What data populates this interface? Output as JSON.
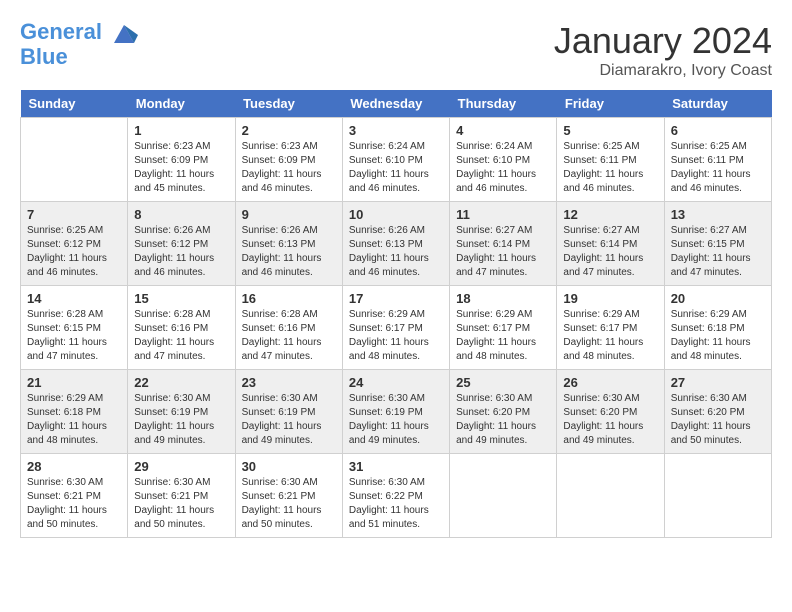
{
  "header": {
    "logo_line1": "General",
    "logo_line2": "Blue",
    "month": "January 2024",
    "location": "Diamarakro, Ivory Coast"
  },
  "days_of_week": [
    "Sunday",
    "Monday",
    "Tuesday",
    "Wednesday",
    "Thursday",
    "Friday",
    "Saturday"
  ],
  "weeks": [
    [
      {
        "day": "",
        "info": ""
      },
      {
        "day": "1",
        "info": "Sunrise: 6:23 AM\nSunset: 6:09 PM\nDaylight: 11 hours\nand 45 minutes."
      },
      {
        "day": "2",
        "info": "Sunrise: 6:23 AM\nSunset: 6:09 PM\nDaylight: 11 hours\nand 46 minutes."
      },
      {
        "day": "3",
        "info": "Sunrise: 6:24 AM\nSunset: 6:10 PM\nDaylight: 11 hours\nand 46 minutes."
      },
      {
        "day": "4",
        "info": "Sunrise: 6:24 AM\nSunset: 6:10 PM\nDaylight: 11 hours\nand 46 minutes."
      },
      {
        "day": "5",
        "info": "Sunrise: 6:25 AM\nSunset: 6:11 PM\nDaylight: 11 hours\nand 46 minutes."
      },
      {
        "day": "6",
        "info": "Sunrise: 6:25 AM\nSunset: 6:11 PM\nDaylight: 11 hours\nand 46 minutes."
      }
    ],
    [
      {
        "day": "7",
        "info": "Sunrise: 6:25 AM\nSunset: 6:12 PM\nDaylight: 11 hours\nand 46 minutes."
      },
      {
        "day": "8",
        "info": "Sunrise: 6:26 AM\nSunset: 6:12 PM\nDaylight: 11 hours\nand 46 minutes."
      },
      {
        "day": "9",
        "info": "Sunrise: 6:26 AM\nSunset: 6:13 PM\nDaylight: 11 hours\nand 46 minutes."
      },
      {
        "day": "10",
        "info": "Sunrise: 6:26 AM\nSunset: 6:13 PM\nDaylight: 11 hours\nand 46 minutes."
      },
      {
        "day": "11",
        "info": "Sunrise: 6:27 AM\nSunset: 6:14 PM\nDaylight: 11 hours\nand 47 minutes."
      },
      {
        "day": "12",
        "info": "Sunrise: 6:27 AM\nSunset: 6:14 PM\nDaylight: 11 hours\nand 47 minutes."
      },
      {
        "day": "13",
        "info": "Sunrise: 6:27 AM\nSunset: 6:15 PM\nDaylight: 11 hours\nand 47 minutes."
      }
    ],
    [
      {
        "day": "14",
        "info": "Sunrise: 6:28 AM\nSunset: 6:15 PM\nDaylight: 11 hours\nand 47 minutes."
      },
      {
        "day": "15",
        "info": "Sunrise: 6:28 AM\nSunset: 6:16 PM\nDaylight: 11 hours\nand 47 minutes."
      },
      {
        "day": "16",
        "info": "Sunrise: 6:28 AM\nSunset: 6:16 PM\nDaylight: 11 hours\nand 47 minutes."
      },
      {
        "day": "17",
        "info": "Sunrise: 6:29 AM\nSunset: 6:17 PM\nDaylight: 11 hours\nand 48 minutes."
      },
      {
        "day": "18",
        "info": "Sunrise: 6:29 AM\nSunset: 6:17 PM\nDaylight: 11 hours\nand 48 minutes."
      },
      {
        "day": "19",
        "info": "Sunrise: 6:29 AM\nSunset: 6:17 PM\nDaylight: 11 hours\nand 48 minutes."
      },
      {
        "day": "20",
        "info": "Sunrise: 6:29 AM\nSunset: 6:18 PM\nDaylight: 11 hours\nand 48 minutes."
      }
    ],
    [
      {
        "day": "21",
        "info": "Sunrise: 6:29 AM\nSunset: 6:18 PM\nDaylight: 11 hours\nand 48 minutes."
      },
      {
        "day": "22",
        "info": "Sunrise: 6:30 AM\nSunset: 6:19 PM\nDaylight: 11 hours\nand 49 minutes."
      },
      {
        "day": "23",
        "info": "Sunrise: 6:30 AM\nSunset: 6:19 PM\nDaylight: 11 hours\nand 49 minutes."
      },
      {
        "day": "24",
        "info": "Sunrise: 6:30 AM\nSunset: 6:19 PM\nDaylight: 11 hours\nand 49 minutes."
      },
      {
        "day": "25",
        "info": "Sunrise: 6:30 AM\nSunset: 6:20 PM\nDaylight: 11 hours\nand 49 minutes."
      },
      {
        "day": "26",
        "info": "Sunrise: 6:30 AM\nSunset: 6:20 PM\nDaylight: 11 hours\nand 49 minutes."
      },
      {
        "day": "27",
        "info": "Sunrise: 6:30 AM\nSunset: 6:20 PM\nDaylight: 11 hours\nand 50 minutes."
      }
    ],
    [
      {
        "day": "28",
        "info": "Sunrise: 6:30 AM\nSunset: 6:21 PM\nDaylight: 11 hours\nand 50 minutes."
      },
      {
        "day": "29",
        "info": "Sunrise: 6:30 AM\nSunset: 6:21 PM\nDaylight: 11 hours\nand 50 minutes."
      },
      {
        "day": "30",
        "info": "Sunrise: 6:30 AM\nSunset: 6:21 PM\nDaylight: 11 hours\nand 50 minutes."
      },
      {
        "day": "31",
        "info": "Sunrise: 6:30 AM\nSunset: 6:22 PM\nDaylight: 11 hours\nand 51 minutes."
      },
      {
        "day": "",
        "info": ""
      },
      {
        "day": "",
        "info": ""
      },
      {
        "day": "",
        "info": ""
      }
    ]
  ]
}
